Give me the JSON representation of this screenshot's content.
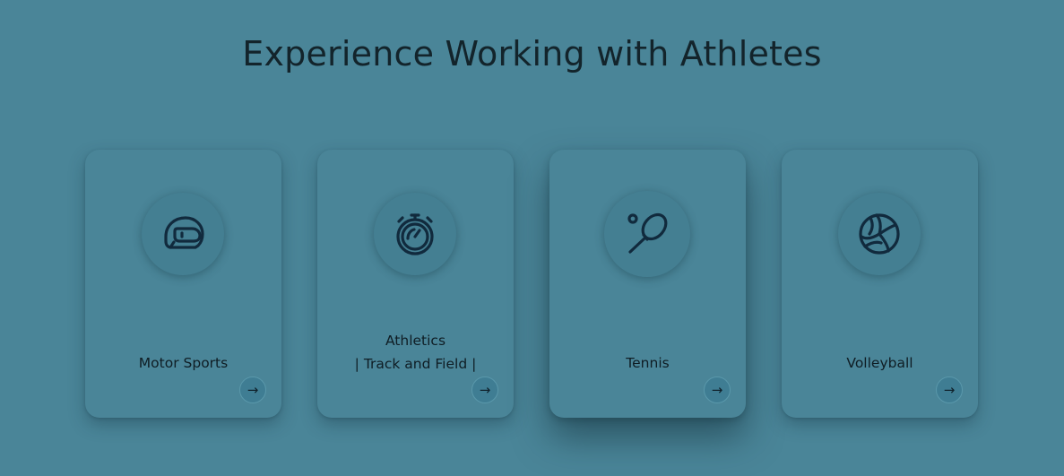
{
  "page": {
    "title": "Experience Working with Athletes"
  },
  "cards": [
    {
      "label_lines": [
        "Motor Sports"
      ],
      "icon": "helmet-icon",
      "arrow": "→"
    },
    {
      "label_lines": [
        "Athletics",
        "| Track and Field |"
      ],
      "icon": "stopwatch-icon",
      "arrow": "→"
    },
    {
      "label_lines": [
        "Tennis"
      ],
      "icon": "tennis-racket-icon",
      "arrow": "→"
    },
    {
      "label_lines": [
        "Volleyball"
      ],
      "icon": "volleyball-icon",
      "arrow": "→"
    }
  ],
  "colors": {
    "background": "#4a8598",
    "icon_stroke": "#112a3d",
    "text": "#0f1d24"
  }
}
